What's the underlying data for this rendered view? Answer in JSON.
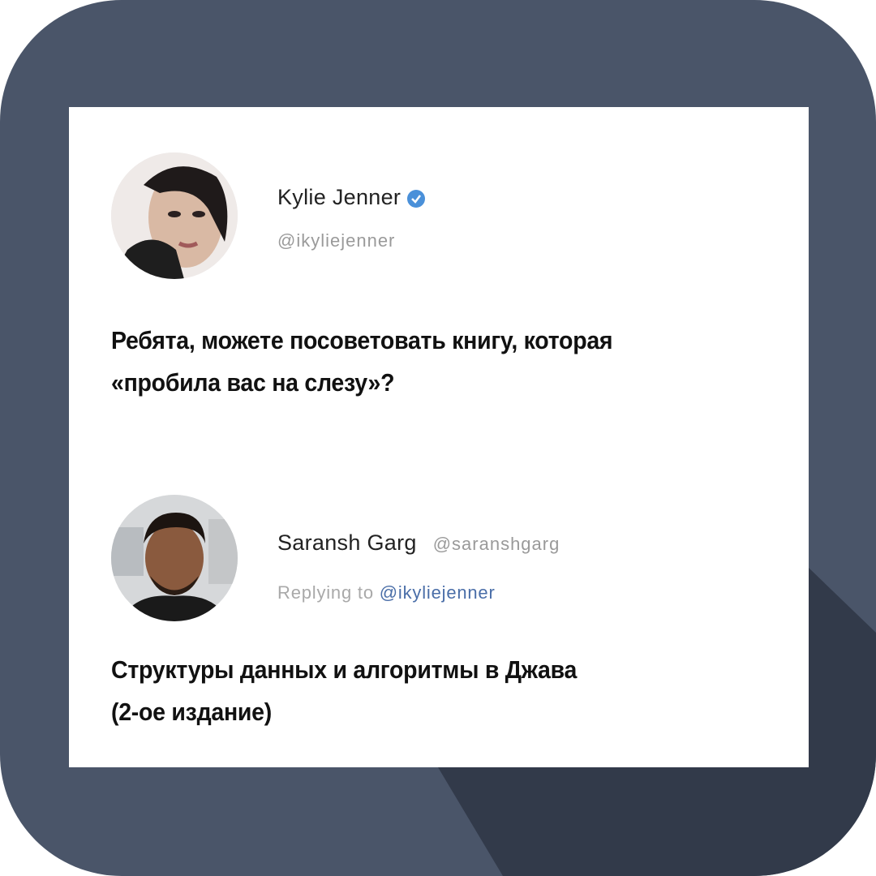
{
  "tweets": [
    {
      "name": "Kylie Jenner",
      "handle": "@ikyliejenner",
      "verified": true,
      "text_line1": "Ребята, можете посоветовать книгу, которая",
      "text_line2": "«пробила вас на слезу»?",
      "avatar": "user-avatar-photo"
    },
    {
      "name": "Saransh Garg",
      "handle": "@saranshgarg",
      "reply_prefix": "Replying to",
      "reply_mention": "@ikyliejenner",
      "text_line1": "Структуры данных и алгоритмы в Джава",
      "text_line2": "(2-ое издание)",
      "avatar": "user-avatar-photo"
    }
  ],
  "colors": {
    "frame": "#4a5569",
    "shadow": "#323a4a",
    "card": "#ffffff",
    "verified": "#4a90d9",
    "mention": "#4a6ea8"
  },
  "icons": [
    "verified-badge-icon"
  ]
}
